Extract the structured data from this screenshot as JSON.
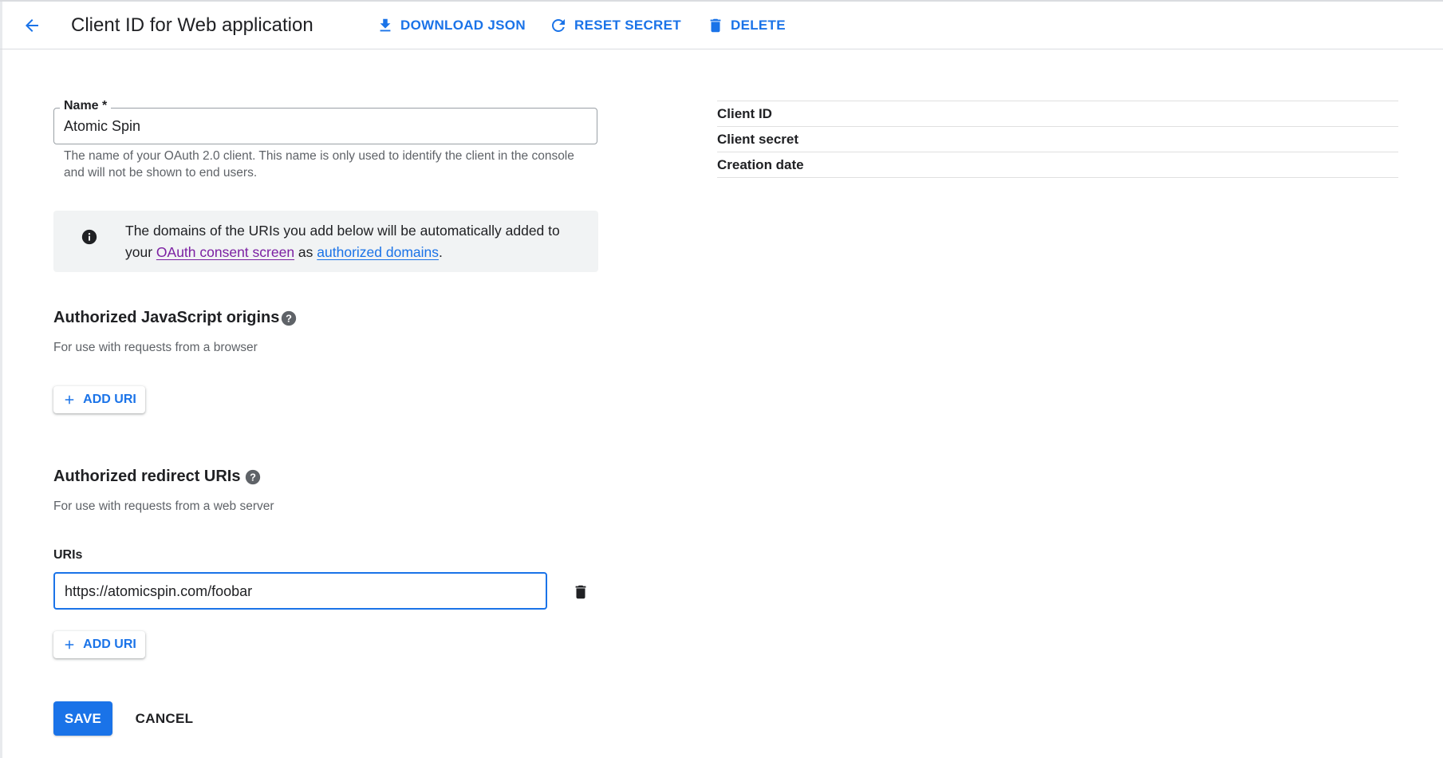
{
  "header": {
    "title": "Client ID for Web application",
    "actions": {
      "download": "DOWNLOAD JSON",
      "reset": "RESET SECRET",
      "delete": "DELETE"
    }
  },
  "name_field": {
    "label": "Name *",
    "value": "Atomic Spin",
    "help": "The name of your OAuth 2.0 client. This name is only used to identify the client in the console and will not be shown to end users."
  },
  "info_box": {
    "text_before": "The domains of the URIs you add below will be automatically added to your ",
    "link1": "OAuth consent screen",
    "text_middle": " as ",
    "link2": "authorized domains",
    "text_after": "."
  },
  "js_origins": {
    "title": "Authorized JavaScript origins",
    "subtitle": "For use with requests from a browser",
    "add_button": "ADD URI"
  },
  "redirect_uris": {
    "title": "Authorized redirect URIs",
    "subtitle": "For use with requests from a web server",
    "uris_label": "URIs",
    "uri_value": "https://atomicspin.com/foobar",
    "add_button": "ADD URI"
  },
  "footer": {
    "save": "SAVE",
    "cancel": "CANCEL"
  },
  "client_info": {
    "rows": [
      {
        "label": "Client ID"
      },
      {
        "label": "Client secret"
      },
      {
        "label": "Creation date"
      }
    ]
  },
  "colors": {
    "accent": "#1a73e8",
    "visited_link": "#7b1fa2",
    "info_bg": "#f1f3f4"
  },
  "icons": {
    "back": "arrow-back-icon",
    "download": "download-icon",
    "reset": "refresh-icon",
    "delete": "trash-icon",
    "info": "info-icon",
    "help": "help-icon",
    "add": "plus-icon"
  }
}
